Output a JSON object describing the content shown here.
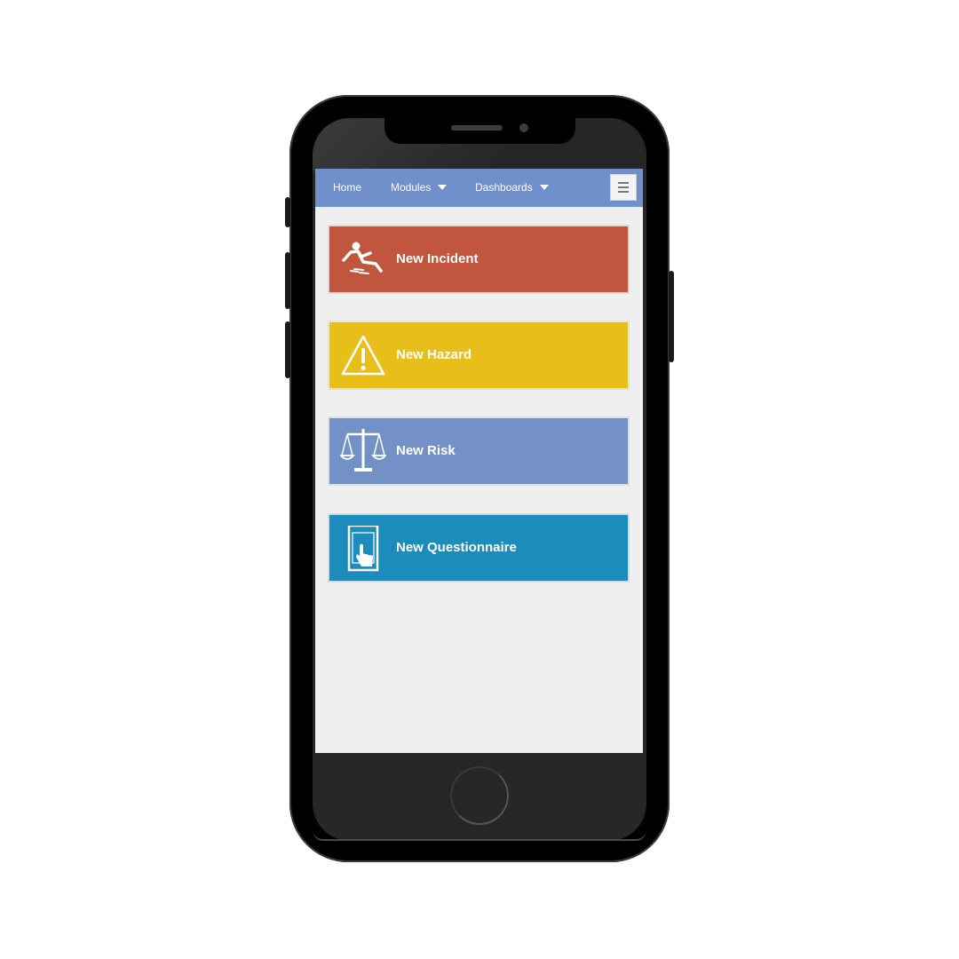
{
  "colors": {
    "navbar": "#7090cc",
    "incident": "#c1553e",
    "hazard": "#e8be1a",
    "risk": "#7390c7",
    "questionnaire": "#1b8cbb",
    "screen_bg": "#efefef"
  },
  "navbar": {
    "home_label": "Home",
    "modules_label": "Modules",
    "dashboards_label": "Dashboards",
    "menu_icon": "hamburger-icon"
  },
  "tiles": [
    {
      "label": "New Incident",
      "icon": "slip-fall-icon"
    },
    {
      "label": "New Hazard",
      "icon": "warning-triangle-icon"
    },
    {
      "label": "New Risk",
      "icon": "scales-icon"
    },
    {
      "label": "New Questionnaire",
      "icon": "tablet-touch-icon"
    }
  ]
}
